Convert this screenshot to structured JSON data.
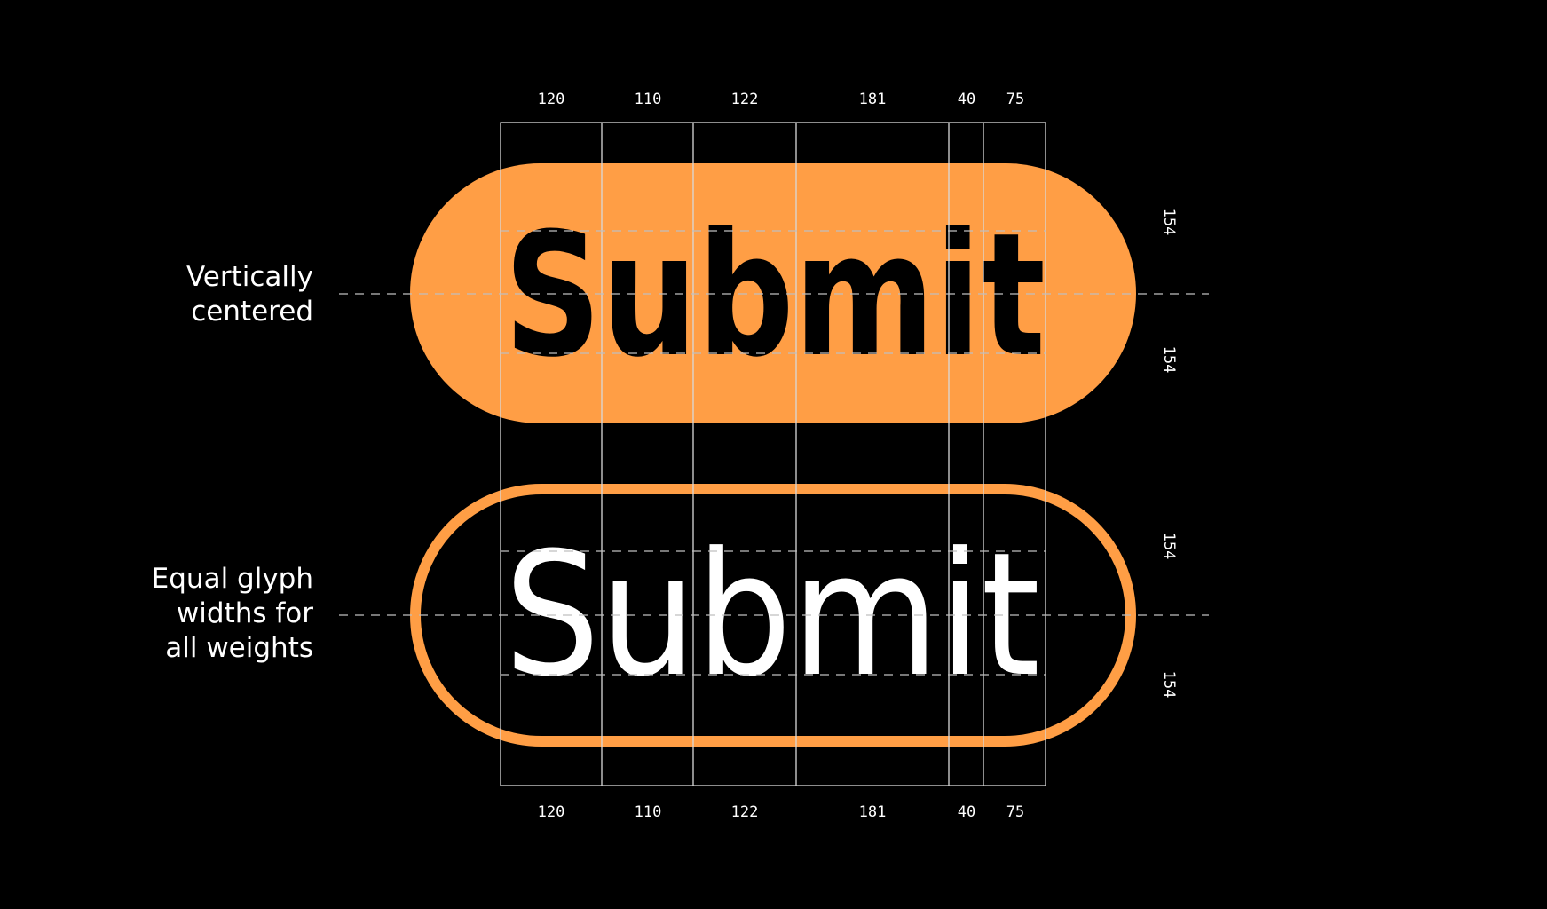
{
  "colors": {
    "background": "#000000",
    "accent": "#FF9E45",
    "guide_line": "#D9D9D9",
    "filled_button_text": "#000000",
    "outline_button_text": "#FFFFFF",
    "annotation_text": "#FFFFFF"
  },
  "labels": {
    "vertically_centered": [
      "Vertically",
      "centered"
    ],
    "equal_widths": [
      "Equal glyph",
      "widths for",
      "all weights"
    ]
  },
  "buttons": {
    "filled": {
      "text": "Submit",
      "weight": "bold",
      "style": "filled"
    },
    "outline": {
      "text": "Submit",
      "weight": "regular",
      "style": "outline"
    }
  },
  "column_widths": [
    "120",
    "110",
    "122",
    "181",
    "40",
    "75"
  ],
  "vertical_spacing": [
    "154",
    "154",
    "154",
    "154"
  ]
}
